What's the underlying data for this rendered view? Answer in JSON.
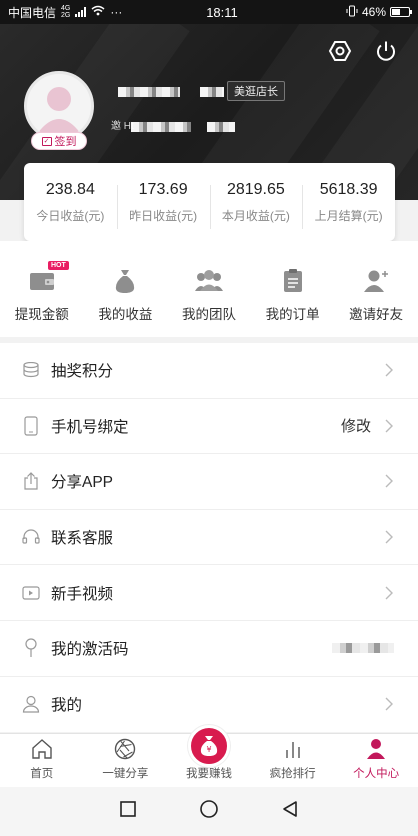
{
  "status_bar": {
    "carrier": "中国电信",
    "network": "4G 2G",
    "more": "···",
    "time": "18:11",
    "battery": "46%"
  },
  "header": {
    "checkin_label": "签到",
    "level_badge": "美逛店长",
    "uid_prefix": "邀 Ht"
  },
  "stats": [
    {
      "value": "238.84",
      "label": "今日收益(元)"
    },
    {
      "value": "173.69",
      "label": "昨日收益(元)"
    },
    {
      "value": "2819.65",
      "label": "本月收益(元)"
    },
    {
      "value": "5618.39",
      "label": "上月结算(元)"
    }
  ],
  "quick_actions": {
    "hot_badge": "HOT",
    "items": [
      {
        "label": "提现金额",
        "icon": "wallet-icon"
      },
      {
        "label": "我的收益",
        "icon": "money-bag-icon"
      },
      {
        "label": "我的团队",
        "icon": "team-icon"
      },
      {
        "label": "我的订单",
        "icon": "order-icon"
      },
      {
        "label": "邀请好友",
        "icon": "invite-icon"
      }
    ]
  },
  "menu": [
    {
      "label": "抽奖积分",
      "icon": "coins-icon",
      "value": ""
    },
    {
      "label": "手机号绑定",
      "icon": "phone-icon",
      "value": "修改"
    },
    {
      "label": "分享APP",
      "icon": "share-icon",
      "value": ""
    },
    {
      "label": "联系客服",
      "icon": "headset-icon",
      "value": ""
    },
    {
      "label": "新手视频",
      "icon": "video-icon",
      "value": ""
    },
    {
      "label": "我的激活码",
      "icon": "pin-icon",
      "value": ""
    },
    {
      "label": "我的",
      "icon": "user-icon",
      "value": ""
    }
  ],
  "tabbar": [
    {
      "label": "首页",
      "icon": "home-icon"
    },
    {
      "label": "一键分享",
      "icon": "aperture-icon"
    },
    {
      "label": "我要赚钱",
      "icon": "money-bag-icon"
    },
    {
      "label": "疯抢排行",
      "icon": "ranking-icon"
    },
    {
      "label": "个人中心",
      "icon": "profile-icon"
    }
  ],
  "colors": {
    "accent": "#c2185b",
    "fab": "#d81b4e",
    "header_bg": "#1f1f1f"
  }
}
